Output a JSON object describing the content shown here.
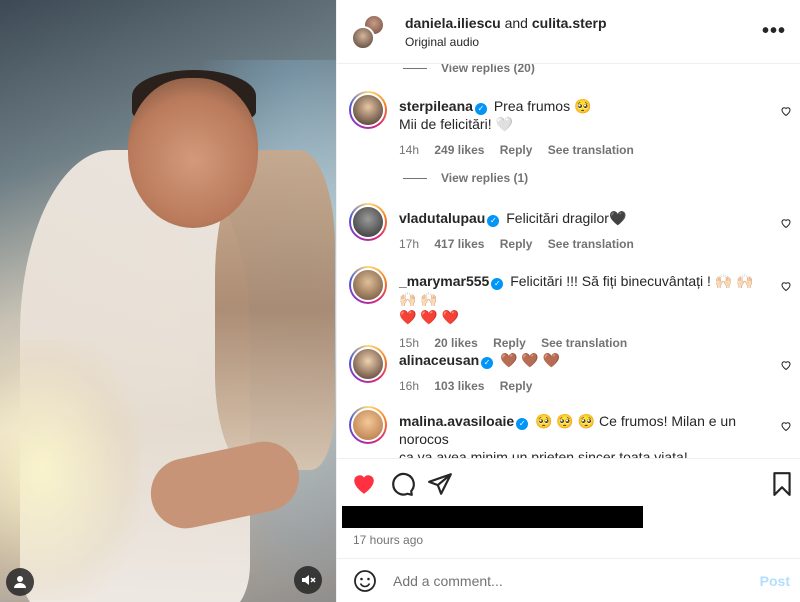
{
  "header": {
    "user1": "daniela.iliescu",
    "and_text": "and",
    "user2": "culita.sterp",
    "audio": "Original audio"
  },
  "comments": [
    {
      "user": "sterpileana",
      "text_lines": [
        "Prea frumos 🥺",
        "Mii de felicitări! 🤍"
      ],
      "time": "14h",
      "likes": "249 likes",
      "reply": "Reply",
      "translation": "See translation",
      "avatar_color": "#c9a47a"
    },
    {
      "user": "vladutalupau",
      "text_lines": [
        "Felicitări dragilor🖤"
      ],
      "time": "17h",
      "likes": "417 likes",
      "reply": "Reply",
      "translation": "See translation",
      "avatar_color": "#555555"
    },
    {
      "user": "_marymar555",
      "text_lines": [
        "Felicitări !!! Să fiți binecuvântați ! 🙌🏻 🙌🏻 🙌🏻 🙌🏻",
        "❤️ ❤️ ❤️"
      ],
      "time": "15h",
      "likes": "20 likes",
      "reply": "Reply",
      "translation": "See translation",
      "avatar_color": "#b08a62"
    },
    {
      "user": "alinaceusan",
      "text_lines": [
        "🤎 🤎 🤎"
      ],
      "time": "16h",
      "likes": "103 likes",
      "reply": "Reply",
      "avatar_color": "#8a5a44"
    },
    {
      "user": "malina.avasiloaie",
      "text_lines": [
        "🥺 🥺 🥺 Ce frumos! Milan e un norocos",
        "ca va avea minim un prieten sincer toata viata!"
      ],
      "avatar_color": "#d9a06a"
    }
  ],
  "view_replies": [
    "View replies (20)",
    "View replies (1)"
  ],
  "actions": {
    "like_icon": "heart-filled-icon",
    "comment_icon": "comment-icon",
    "share_icon": "share-icon",
    "save_icon": "bookmark-icon",
    "time_ago": "17 hours ago"
  },
  "add_comment": {
    "placeholder": "Add a comment...",
    "post_label": "Post"
  },
  "colors": {
    "like_red": "#ff3040",
    "verified_blue": "#0095f6",
    "post_disabled": "#b2dffc",
    "muted_text": "#737373"
  }
}
